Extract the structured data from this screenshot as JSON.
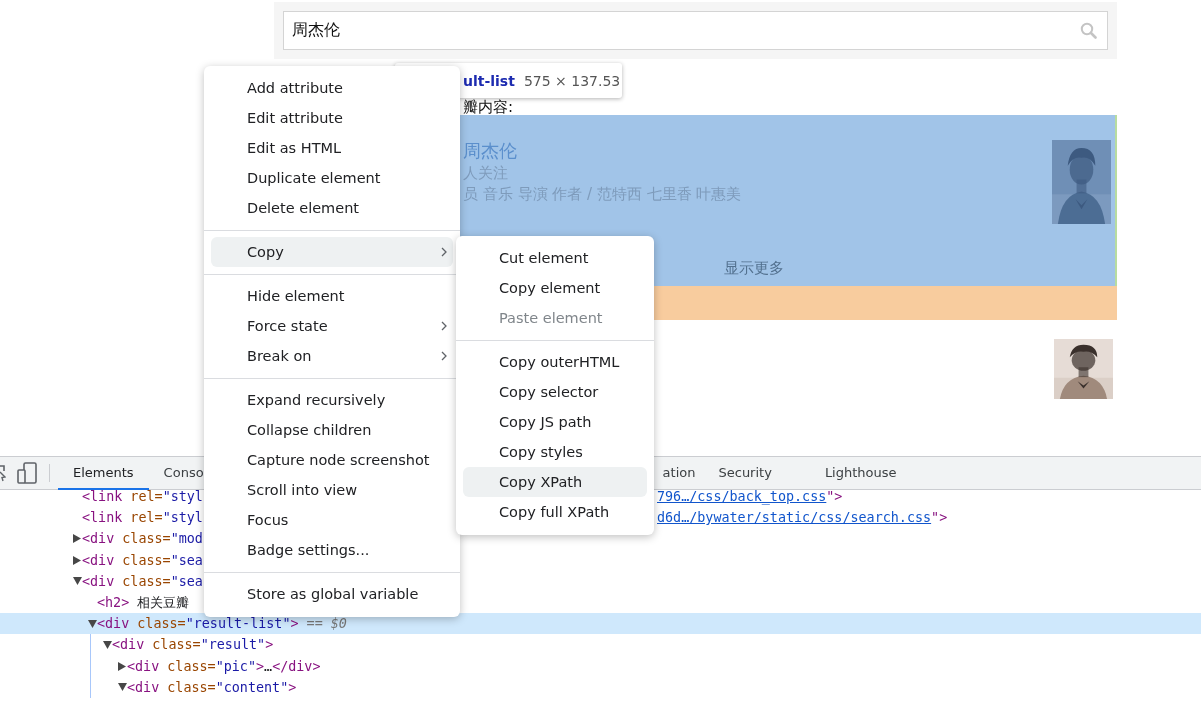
{
  "search": {
    "value": "周杰伦"
  },
  "inspect_tooltip": {
    "selector": "ult-list",
    "size": "575 × 137.53"
  },
  "results_heading": "瓣内容:",
  "highlighted_result": {
    "title": "周杰伦",
    "followers": "人关注",
    "tags": "员 音乐 导演 作者 / 范特西 七里香 叶惠美",
    "more": "显示更多"
  },
  "devtools": {
    "tabs": [
      {
        "label": "Elements",
        "selected": true
      },
      {
        "label": "Conso",
        "selected": false
      },
      {
        "label": "ation",
        "selected": false
      },
      {
        "label": "Security",
        "selected": false
      },
      {
        "label": "Lighthouse",
        "selected": false
      }
    ],
    "dom_tree": [
      {
        "selected": false,
        "parts": [
          {
            "kind": "tag",
            "text": "<link"
          },
          {
            "kind": "attr",
            "text": " rel="
          },
          {
            "kind": "value",
            "text": "\"styl"
          }
        ],
        "tail": [
          {
            "kind": "link",
            "text": "796…/css/back_top.css"
          },
          {
            "kind": "tag",
            "text": "\">"
          }
        ]
      },
      {
        "selected": false,
        "parts": [
          {
            "kind": "tag",
            "text": "<link"
          },
          {
            "kind": "attr",
            "text": " rel="
          },
          {
            "kind": "value",
            "text": "\"styl"
          }
        ],
        "tail": [
          {
            "kind": "link",
            "text": "d6d…/bywater/static/css/search.css"
          },
          {
            "kind": "tag",
            "text": "\">"
          }
        ]
      },
      {
        "selected": false,
        "expanded": false,
        "parts": [
          {
            "kind": "tag",
            "text": "<div"
          },
          {
            "kind": "attr",
            "text": " class="
          },
          {
            "kind": "value",
            "text": "\"mod"
          }
        ]
      },
      {
        "selected": false,
        "expanded": false,
        "parts": [
          {
            "kind": "tag",
            "text": "<div"
          },
          {
            "kind": "attr",
            "text": " class="
          },
          {
            "kind": "value",
            "text": "\"sea"
          }
        ]
      },
      {
        "selected": false,
        "expanded": true,
        "parts": [
          {
            "kind": "tag",
            "text": "<div"
          },
          {
            "kind": "attr",
            "text": " class="
          },
          {
            "kind": "value",
            "text": "\"sea"
          }
        ],
        "children": [
          {
            "selected": false,
            "parts": [
              {
                "kind": "tag",
                "text": "<h2>"
              },
              {
                "kind": "text",
                "text": " 相关豆瓣"
              }
            ]
          },
          {
            "selected": true,
            "expanded": true,
            "parts": [
              {
                "kind": "tag",
                "text": "<div"
              },
              {
                "kind": "attr",
                "text": " class="
              },
              {
                "kind": "value",
                "text": "\"result-list\""
              },
              {
                "kind": "tag",
                "text": ">"
              },
              {
                "kind": "dim",
                "text": " == $0"
              }
            ],
            "children": [
              {
                "selected": false,
                "expanded": true,
                "parts": [
                  {
                    "kind": "tag",
                    "text": "<div"
                  },
                  {
                    "kind": "attr",
                    "text": " class="
                  },
                  {
                    "kind": "value",
                    "text": "\"result\""
                  },
                  {
                    "kind": "tag",
                    "text": ">"
                  }
                ],
                "children": [
                  {
                    "selected": false,
                    "expanded": false,
                    "parts": [
                      {
                        "kind": "tag",
                        "text": "<div"
                      },
                      {
                        "kind": "attr",
                        "text": " class="
                      },
                      {
                        "kind": "value",
                        "text": "\"pic\""
                      },
                      {
                        "kind": "tag",
                        "text": ">"
                      },
                      {
                        "kind": "text",
                        "text": "…"
                      },
                      {
                        "kind": "tag",
                        "text": "</div>"
                      }
                    ]
                  },
                  {
                    "selected": false,
                    "expanded": true,
                    "parts": [
                      {
                        "kind": "tag",
                        "text": "<div"
                      },
                      {
                        "kind": "attr",
                        "text": " class="
                      },
                      {
                        "kind": "value",
                        "text": "\"content\""
                      },
                      {
                        "kind": "tag",
                        "text": ">"
                      }
                    ]
                  }
                ]
              }
            ]
          }
        ]
      }
    ]
  },
  "context_menu": {
    "items": [
      {
        "kind": "item",
        "label": "Add attribute",
        "selected": false
      },
      {
        "kind": "item",
        "label": "Edit attribute",
        "selected": false
      },
      {
        "kind": "item",
        "label": "Edit as HTML",
        "selected": false
      },
      {
        "kind": "item",
        "label": "Duplicate element",
        "selected": false
      },
      {
        "kind": "item",
        "label": "Delete element",
        "selected": false
      },
      {
        "kind": "separator"
      },
      {
        "kind": "item",
        "label": "Copy",
        "selected": true,
        "submenu": true
      },
      {
        "kind": "separator"
      },
      {
        "kind": "item",
        "label": "Hide element",
        "selected": false
      },
      {
        "kind": "item",
        "label": "Force state",
        "selected": false,
        "submenu": true
      },
      {
        "kind": "item",
        "label": "Break on",
        "selected": false,
        "submenu": true
      },
      {
        "kind": "separator"
      },
      {
        "kind": "item",
        "label": "Expand recursively",
        "selected": false
      },
      {
        "kind": "item",
        "label": "Collapse children",
        "selected": false
      },
      {
        "kind": "item",
        "label": "Capture node screenshot",
        "selected": false
      },
      {
        "kind": "item",
        "label": "Scroll into view",
        "selected": false
      },
      {
        "kind": "item",
        "label": "Focus",
        "selected": false
      },
      {
        "kind": "item",
        "label": "Badge settings...",
        "selected": false
      },
      {
        "kind": "separator"
      },
      {
        "kind": "item",
        "label": "Store as global variable",
        "selected": false
      }
    ]
  },
  "copy_submenu": {
    "items": [
      {
        "kind": "item",
        "label": "Cut element",
        "selected": false,
        "disabled": false
      },
      {
        "kind": "item",
        "label": "Copy element",
        "selected": false,
        "disabled": false
      },
      {
        "kind": "item",
        "label": "Paste element",
        "selected": false,
        "disabled": true
      },
      {
        "kind": "separator"
      },
      {
        "kind": "item",
        "label": "Copy outerHTML",
        "selected": false,
        "disabled": false
      },
      {
        "kind": "item",
        "label": "Copy selector",
        "selected": false,
        "disabled": false
      },
      {
        "kind": "item",
        "label": "Copy JS path",
        "selected": false,
        "disabled": false
      },
      {
        "kind": "item",
        "label": "Copy styles",
        "selected": false,
        "disabled": false
      },
      {
        "kind": "item",
        "label": "Copy XPath",
        "selected": true,
        "disabled": false
      },
      {
        "kind": "item",
        "label": "Copy full XPath",
        "selected": false,
        "disabled": false
      }
    ]
  }
}
